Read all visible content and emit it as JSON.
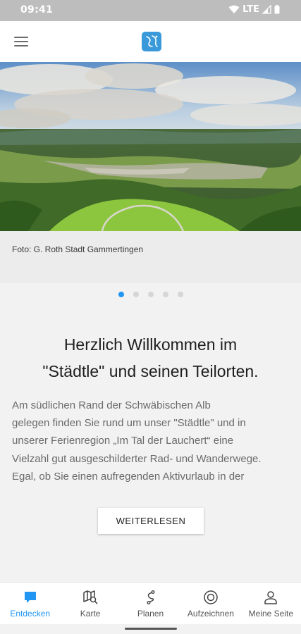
{
  "status": {
    "time": "09:41",
    "network": "LTE"
  },
  "appbar": {
    "menu_icon": "hamburger-menu-icon",
    "logo_icon": "app-logo-icon"
  },
  "hero": {
    "caption": "Foto: G. Roth Stadt Gammertingen",
    "slide_count": 5,
    "active_slide": 1
  },
  "content": {
    "headline_line1": "Herzlich Willkommen im",
    "headline_line2": "\"Städtle\" und seinen Teilorten.",
    "body_lines": [
      "Am südlichen Rand der Schwäbischen Alb",
      "gelegen finden Sie rund um unser \"Städtle\" und in",
      "unserer Ferienregion „Im Tal der Lauchert“  eine",
      "Vielzahl gut ausgeschilderter Rad- und Wanderwege.",
      "Egal, ob Sie einen aufregenden Aktivurlaub in der"
    ],
    "readmore_label": "WEITERLESEN"
  },
  "bottom_nav": {
    "items": [
      {
        "label": "Entdecken",
        "icon": "chat-bubble-icon",
        "active": true
      },
      {
        "label": "Karte",
        "icon": "map-search-icon",
        "active": false
      },
      {
        "label": "Planen",
        "icon": "route-icon",
        "active": false
      },
      {
        "label": "Aufzeichnen",
        "icon": "record-icon",
        "active": false
      },
      {
        "label": "Meine Seite",
        "icon": "person-icon",
        "active": false
      }
    ]
  },
  "colors": {
    "accent": "#2196f3",
    "statusbar": "#bdbdbd",
    "logo": "#3a9ad9"
  }
}
